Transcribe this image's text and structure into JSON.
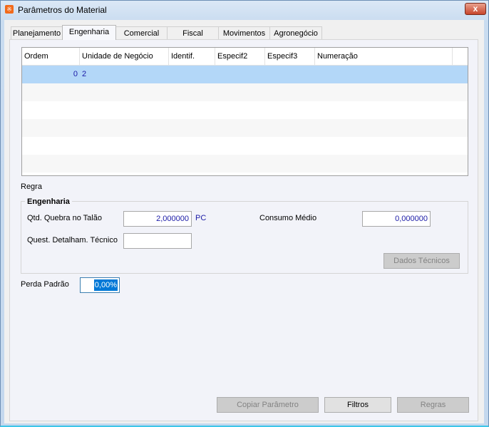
{
  "window": {
    "title": "Parâmetros do Material",
    "close_label": "x"
  },
  "tabs": [
    "Planejamento",
    "Engenharia",
    "Comercial",
    "Fiscal",
    "Movimentos",
    "Agronegócio"
  ],
  "grid": {
    "columns": [
      "Ordem",
      "Unidade de Negócio",
      "Identif.",
      "Especif2",
      "Especif3",
      "Numeração"
    ],
    "rows": [
      {
        "ordem": "0",
        "unidade": "2",
        "identif": "",
        "especif2": "",
        "especif3": "",
        "numeracao": ""
      }
    ]
  },
  "regra_label": "Regra",
  "engenharia": {
    "legend": "Engenharia",
    "qtd_label": "Qtd. Quebra no Talão",
    "qtd_value": "2,000000",
    "qtd_unit": "PC",
    "consumo_label": "Consumo Médio",
    "consumo_value": "0,000000",
    "quest_label": "Quest. Detalham. Técnico",
    "quest_value": "",
    "dados_button": "Dados Técnicos"
  },
  "perda": {
    "label": "Perda Padrão",
    "value": "0,00%"
  },
  "buttons": {
    "copiar": "Copiar Parâmetro",
    "filtros": "Filtros",
    "regras": "Regras"
  }
}
